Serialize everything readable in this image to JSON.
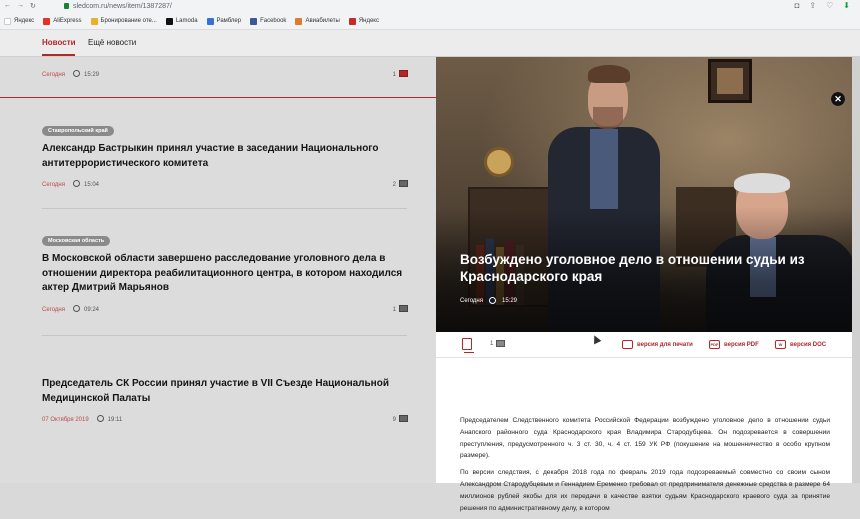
{
  "browser": {
    "url": "sledcom.ru/news/item/1387287/",
    "bookmarks": [
      {
        "label": "Яндекс",
        "color": "#ffffff"
      },
      {
        "label": "AliExpress",
        "color": "#e43225"
      },
      {
        "label": "Бронирование оте...",
        "color": "#e8b02b"
      },
      {
        "label": "Lamoda",
        "color": "#111111"
      },
      {
        "label": "Рамблер",
        "color": "#3b6fd8"
      },
      {
        "label": "Facebook",
        "color": "#3b5998"
      },
      {
        "label": "Авиабилеты",
        "color": "#e37a2d"
      },
      {
        "label": "Яндекс",
        "color": "#c42b2b"
      }
    ]
  },
  "nav": {
    "tabs": [
      {
        "label": "Новости",
        "active": true
      },
      {
        "label": "Ещё новости",
        "active": false
      }
    ]
  },
  "news": [
    {
      "tag": "",
      "headline": "",
      "date": "Сегодня",
      "time": "15:29",
      "images": "1"
    },
    {
      "tag": "Ставропольский край",
      "headline": "Александр Бастрыкин принял участие в заседании Национального антитеррористического комитета",
      "date": "Сегодня",
      "time": "15:04",
      "images": "2"
    },
    {
      "tag": "Московская область",
      "headline": "В Московской области завершено расследование уголовного дела в отношении директора реабилитационного центра, в котором находился актер Дмитрий Марьянов",
      "date": "Сегодня",
      "time": "09:24",
      "images": "1"
    },
    {
      "tag": "",
      "headline": "Председатель СК России принял участие в VII Съезде Национальной Медицинской Палаты",
      "date": "07 Октября 2019",
      "time": "19:11",
      "images": "9"
    }
  ],
  "article": {
    "title": "Возбуждено уголовное дело в отношении судьи из Краснодарского края",
    "date": "Сегодня",
    "time": "15:29",
    "images": "1",
    "actions": {
      "print": "версия для печати",
      "pdf": "версия PDF",
      "doc": "версия DOC",
      "pdf_icon": "PDF",
      "doc_icon": "W"
    },
    "paragraphs": [
      "Председателем Следственного комитета Российской Федерации возбуждено уголовное дело в отношении судьи Анапского районного суда Краснодарского края Владимира Стародубцева. Он подозревается в совершении преступления, предусмотренного ч. 3 ст. 30, ч. 4 ст. 159 УК РФ (покушение на мошенничество в особо крупном размере).",
      "По версии следствия, с декабря 2018 года по февраль 2019 года подозреваемый совместно со своим сыном Александром Стародубцевым и Геннадием Еременко требовал от предпринимателя денежные средства в размере 64 миллионов рублей якобы для их передачи в качестве взятки судьям Краснодарского краевого суда за принятие решения по административному делу, в котором"
    ]
  },
  "colors": {
    "accent": "#b0282a",
    "tag_bg": "#8a8a8a"
  }
}
